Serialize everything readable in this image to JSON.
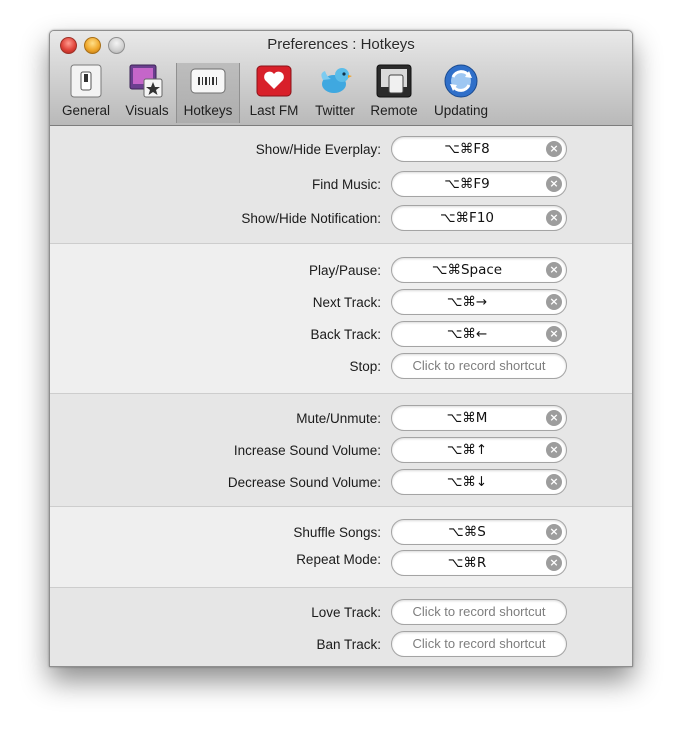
{
  "window": {
    "title": "Preferences : Hotkeys"
  },
  "toolbar": {
    "items": [
      {
        "label": "General",
        "icon": "switch-icon"
      },
      {
        "label": "Visuals",
        "icon": "visuals-star-icon"
      },
      {
        "label": "Hotkeys",
        "icon": "keyboard-icon",
        "selected": true
      },
      {
        "label": "Last FM",
        "icon": "heart-icon"
      },
      {
        "label": "Twitter",
        "icon": "twitter-bird-icon"
      },
      {
        "label": "Remote",
        "icon": "remote-icon"
      },
      {
        "label": "Updating",
        "icon": "update-sync-icon"
      }
    ]
  },
  "placeholder": "Click to record shortcut",
  "groups": [
    {
      "rows": [
        {
          "label": "Show/Hide Everplay:",
          "shortcut": "⌥⌘F8"
        },
        {
          "label": "Find Music:",
          "shortcut": "⌥⌘F9"
        },
        {
          "label": "Show/Hide Notification:",
          "shortcut": "⌥⌘F10"
        }
      ]
    },
    {
      "rows": [
        {
          "label": "Play/Pause:",
          "shortcut": "⌥⌘Space"
        },
        {
          "label": "Next Track:",
          "shortcut": "⌥⌘→"
        },
        {
          "label": "Back Track:",
          "shortcut": "⌥⌘←"
        },
        {
          "label": "Stop:",
          "shortcut": null
        }
      ]
    },
    {
      "rows": [
        {
          "label": "Mute/Unmute:",
          "shortcut": "⌥⌘M"
        },
        {
          "label": "Increase Sound Volume:",
          "shortcut": "⌥⌘↑"
        },
        {
          "label": "Decrease Sound Volume:",
          "shortcut": "⌥⌘↓"
        }
      ]
    },
    {
      "rows": [
        {
          "label": "Shuffle Songs:",
          "shortcut": "⌥⌘S"
        },
        {
          "label": "Repeat Mode:",
          "shortcut": "⌥⌘R"
        }
      ]
    },
    {
      "rows": [
        {
          "label": "Love Track:",
          "shortcut": null
        },
        {
          "label": "Ban Track:",
          "shortcut": null
        }
      ]
    }
  ],
  "clear_glyph": "×"
}
